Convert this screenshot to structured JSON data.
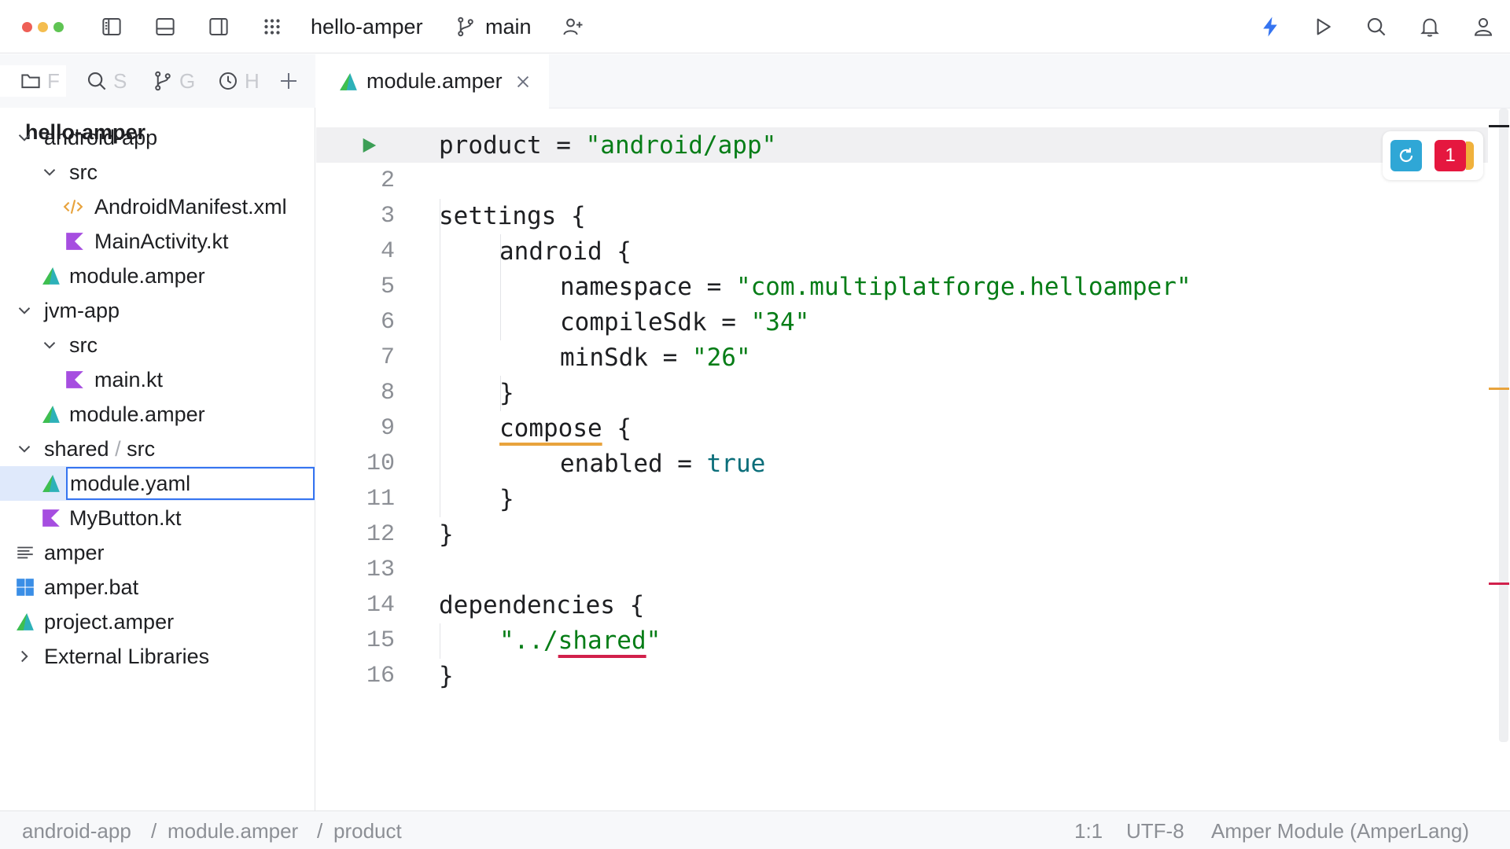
{
  "toolbar": {
    "project_name": "hello-amper",
    "branch": "main",
    "icons": [
      "left-panel-icon",
      "bottom-panel-icon",
      "right-panel-icon",
      "app-grid-icon",
      "branch-icon",
      "add-user-icon",
      "lightning-icon",
      "run-icon",
      "search-icon",
      "bell-icon",
      "user-icon"
    ],
    "colors": {
      "accent": "#3574f0",
      "close": "#ee5f56",
      "minimize": "#f4bd4f",
      "maximize": "#5fc453"
    }
  },
  "left_panel": {
    "tabs": [
      {
        "label": "F",
        "icon": "folder-icon"
      },
      {
        "label": "S",
        "icon": "search-icon"
      },
      {
        "label": "G",
        "icon": "git-icon"
      },
      {
        "label": "H",
        "icon": "clock-icon"
      }
    ],
    "project_root": "hello-amper",
    "tree": [
      {
        "label": "android-app",
        "icon": "chevron-down-icon"
      },
      {
        "label": "src",
        "icon": "chevron-down-icon"
      },
      {
        "label": "AndroidManifest.xml",
        "icon": "xml-file-icon"
      },
      {
        "label": "MainActivity.kt",
        "icon": "kotlin-file-icon"
      },
      {
        "label": "module.amper",
        "icon": "amper-file-icon"
      },
      {
        "label": "jvm-app",
        "icon": "chevron-down-icon"
      },
      {
        "label": "src",
        "icon": "chevron-down-icon"
      },
      {
        "label": "main.kt",
        "icon": "kotlin-file-icon"
      },
      {
        "label": "module.amper",
        "icon": "amper-file-icon"
      },
      {
        "label": "shared",
        "label_sep": "/",
        "label_tail": "src",
        "icon": "chevron-down-icon"
      },
      {
        "label": "module.yaml",
        "icon": "amper-file-icon",
        "editing": true
      },
      {
        "label": "MyButton.kt",
        "icon": "kotlin-file-icon"
      },
      {
        "label": "amper",
        "icon": "text-file-icon"
      },
      {
        "label": "amper.bat",
        "icon": "windows-file-icon"
      },
      {
        "label": "project.amper",
        "icon": "amper-file-icon"
      },
      {
        "label": "External Libraries",
        "icon": "chevron-right-icon"
      }
    ]
  },
  "editor": {
    "tab_title": "module.amper",
    "line_numbers": [
      "2",
      "3",
      "4",
      "5",
      "6",
      "7",
      "8",
      "9",
      "10",
      "11",
      "12",
      "13",
      "14",
      "15",
      "16"
    ],
    "code": {
      "l1_key": "product = ",
      "l1_str": "\"android/app\"",
      "l3": "settings {",
      "l4": "android {",
      "l5_key": "namespace = ",
      "l5_str": "\"com.multiplatforge.helloamper\"",
      "l6_key": "compileSdk = ",
      "l6_str": "\"34\"",
      "l7_key": "minSdk = ",
      "l7_str": "\"26\"",
      "l8": "}",
      "l9_warn": "compose",
      "l9_tail": " {",
      "l10_key": "enabled = ",
      "l10_kw": "true",
      "l11": "}",
      "l12": "}",
      "l14": "dependencies {",
      "l15_a": "\"../",
      "l15_err": "shared",
      "l15_b": "\"",
      "l16": "}"
    },
    "error_count": "1"
  },
  "status_bar": {
    "breadcrumbs": [
      "android-app",
      "module.amper",
      "product"
    ],
    "breadcrumb_sep": "/",
    "position": "1:1",
    "encoding": "UTF-8",
    "file_type": "Amper Module (AmperLang)"
  }
}
